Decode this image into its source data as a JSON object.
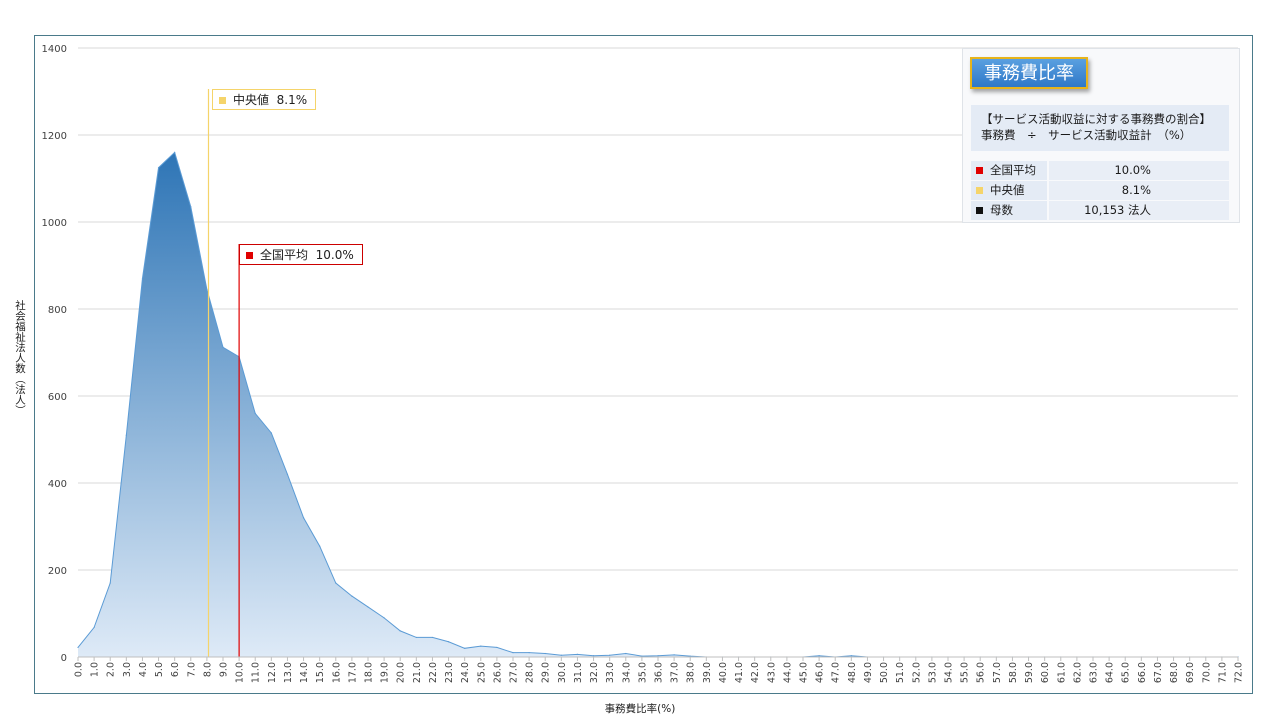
{
  "colors": {
    "area_top": "#2e75b6",
    "area_bottom": "#deeaf7",
    "area_line": "#5b9bd5",
    "mean": "#e00000",
    "median": "#f5d46a",
    "count": "#111111",
    "grid": "#d9d9d9"
  },
  "panel": {
    "title": "事務費比率",
    "desc_line1": "【サービス活動収益に対する事務費の割合】",
    "desc_line2": "事務費　÷　サービス活動収益計　（%）",
    "rows": [
      {
        "label": "全国平均",
        "value": "10.0%"
      },
      {
        "label": "中央値",
        "value": "8.1%"
      },
      {
        "label": "母数",
        "value": "10,153  法人"
      }
    ]
  },
  "callouts": {
    "median": {
      "label": "中央値",
      "value": "8.1%"
    },
    "mean": {
      "label": "全国平均",
      "value": "10.0%"
    }
  },
  "chart_data": {
    "type": "area",
    "title": "",
    "xlabel": "事務費比率(%)",
    "ylabel": "社会福祉法人数（法人）",
    "ylim": [
      0,
      1400
    ],
    "yticks": [
      "0",
      "200",
      "400",
      "600",
      "800",
      "1000",
      "1200",
      "1400"
    ],
    "grid": true,
    "x": [
      "0.0",
      "1.0",
      "2.0",
      "3.0",
      "4.0",
      "5.0",
      "6.0",
      "7.0",
      "8.0",
      "9.0",
      "10.0",
      "11.0",
      "12.0",
      "13.0",
      "14.0",
      "15.0",
      "16.0",
      "17.0",
      "18.0",
      "19.0",
      "20.0",
      "21.0",
      "22.0",
      "23.0",
      "24.0",
      "25.0",
      "26.0",
      "27.0",
      "28.0",
      "29.0",
      "30.0",
      "31.0",
      "32.0",
      "33.0",
      "34.0",
      "35.0",
      "36.0",
      "37.0",
      "38.0",
      "39.0",
      "40.0",
      "41.0",
      "42.0",
      "43.0",
      "44.0",
      "45.0",
      "46.0",
      "47.0",
      "48.0",
      "49.0",
      "50.0",
      "51.0",
      "52.0",
      "53.0",
      "54.0",
      "55.0",
      "56.0",
      "57.0",
      "58.0",
      "59.0",
      "60.0",
      "61.0",
      "62.0",
      "63.0",
      "64.0",
      "65.0",
      "66.0",
      "67.0",
      "68.0",
      "69.0",
      "70.0",
      "71.0",
      "72.0"
    ],
    "values": [
      22,
      68,
      170,
      510,
      870,
      1125,
      1160,
      1035,
      845,
      712,
      690,
      560,
      515,
      420,
      320,
      255,
      170,
      140,
      115,
      90,
      60,
      45,
      45,
      35,
      20,
      25,
      22,
      10,
      10,
      8,
      4,
      6,
      3,
      4,
      8,
      2,
      3,
      5,
      2,
      0,
      0,
      0,
      0,
      0,
      0,
      0,
      3,
      0,
      3,
      0,
      0,
      0,
      0,
      0,
      0,
      0,
      0,
      0,
      0,
      0,
      0,
      0,
      0,
      0,
      0,
      0,
      0,
      0,
      0,
      0,
      0,
      0,
      0
    ],
    "mean": 10.0,
    "median": 8.1
  }
}
